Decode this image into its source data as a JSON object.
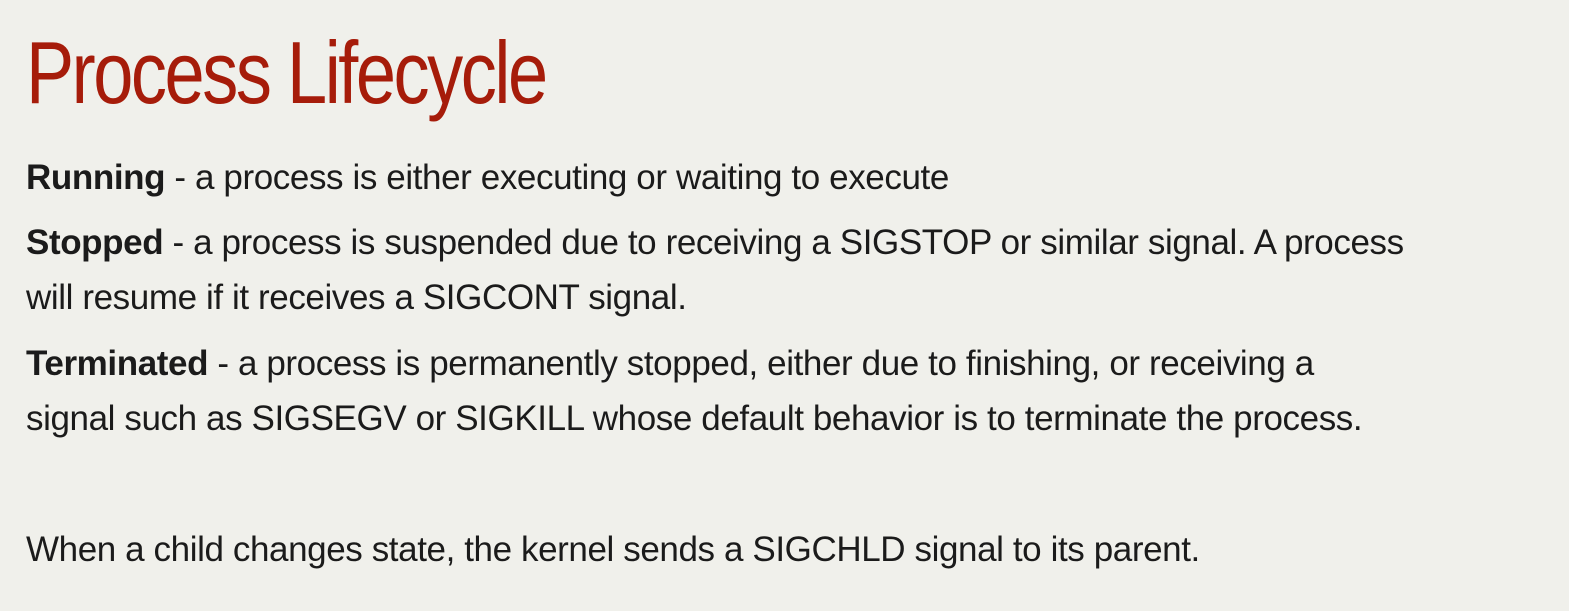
{
  "title": "Process Lifecycle",
  "states": [
    {
      "term": "Running",
      "lines": [
        " - a process is either executing or waiting to execute"
      ]
    },
    {
      "term": "Stopped",
      "lines": [
        " - a process is suspended due to receiving a SIGSTOP or similar signal.  A process",
        "will resume if it receives a SIGCONT signal."
      ]
    },
    {
      "term": "Terminated",
      "lines": [
        " - a process is permanently stopped, either due to finishing, or receiving a",
        "signal such as SIGSEGV or SIGKILL whose default behavior is to terminate the process."
      ]
    }
  ],
  "note": "When a child changes state, the kernel sends a SIGCHLD signal to its parent.",
  "colors": {
    "background": "#f0f0eb",
    "title": "#a61c0a",
    "text": "#1b1b1b"
  }
}
